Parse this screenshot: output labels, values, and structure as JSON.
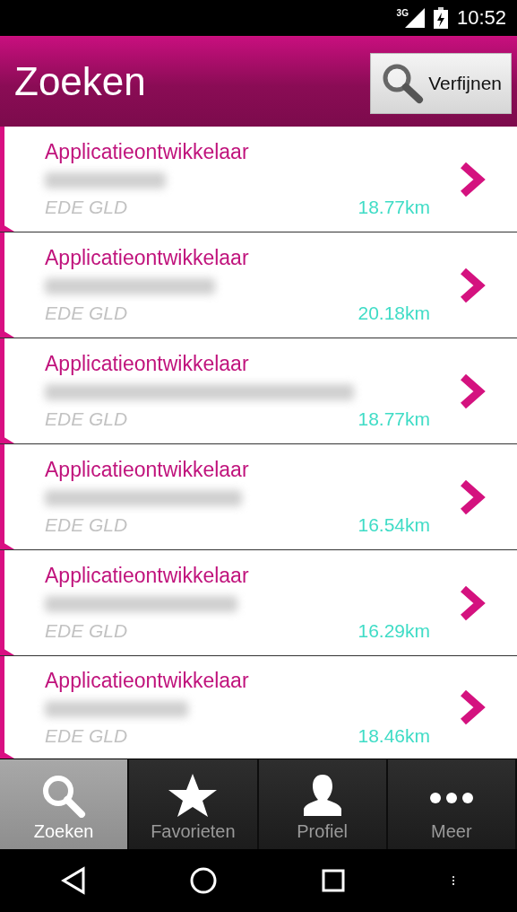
{
  "status_bar": {
    "network": "3G",
    "time": "10:52"
  },
  "header": {
    "title": "Zoeken",
    "refine_button": "Verfijnen"
  },
  "results": [
    {
      "title": "Applicatieontwikkelaar",
      "location": "EDE GLD",
      "distance": "18.77km"
    },
    {
      "title": "Applicatieontwikkelaar",
      "location": "EDE GLD",
      "distance": "20.18km"
    },
    {
      "title": "Applicatieontwikkelaar",
      "location": "EDE GLD",
      "distance": "18.77km"
    },
    {
      "title": "Applicatieontwikkelaar",
      "location": "EDE GLD",
      "distance": "16.54km"
    },
    {
      "title": "Applicatieontwikkelaar",
      "location": "EDE GLD",
      "distance": "16.29km"
    },
    {
      "title": "Applicatieontwikkelaar",
      "location": "EDE GLD",
      "distance": "18.46km"
    }
  ],
  "tabs": [
    {
      "label": "Zoeken",
      "kind": "search",
      "selected": true
    },
    {
      "label": "Favorieten",
      "kind": "star",
      "selected": false
    },
    {
      "label": "Profiel",
      "kind": "person",
      "selected": false
    },
    {
      "label": "Meer",
      "kind": "more",
      "selected": false
    }
  ]
}
